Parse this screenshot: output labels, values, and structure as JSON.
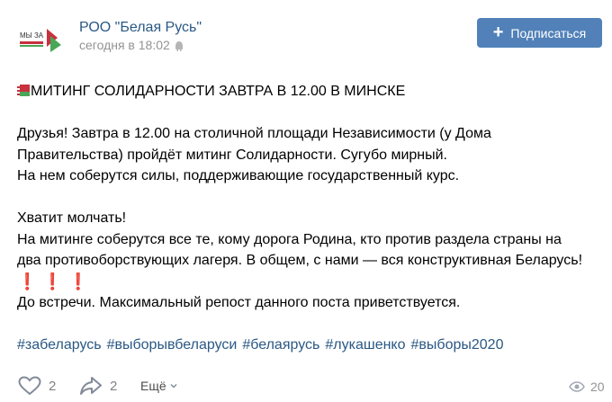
{
  "post": {
    "group_name": "РОО \"Белая Русь\"",
    "avatar_text": "МЫ ЗА",
    "time": "сегодня в 18:02",
    "subscribe_label": "Подписаться",
    "title": "МИТИНГ СОЛИДАРНОСТИ ЗАВТРА В 12.00 В МИНСКЕ",
    "paragraph1": [
      "Друзья! Завтра в 12.00 на столичной площади Независимости (у Дома",
      "Правительства) пройдёт митинг Солидарности. Сугубо мирный.",
      "На нем соберутся силы, поддерживающие государственный курс."
    ],
    "paragraph2": [
      "Хватит молчать!",
      "На митинге соберутся все те, кому дорога Родина, кто против раздела страны на",
      "два противоборствующих лагеря. В общем, с нами — вся конструктивная Беларусь!"
    ],
    "exclamations": "❗❗❗",
    "closing": "До встречи. Максимальный репост данного поста приветствуется.",
    "hashtags": [
      "#забеларусь",
      "#выборывбеларуси",
      "#белаярусь",
      "#лукашенко",
      "#выборы2020"
    ]
  },
  "footer": {
    "likes": "2",
    "shares": "2",
    "more_label": "Ещё",
    "views": "20"
  },
  "colors": {
    "accent": "#5181b8",
    "link": "#2a5885",
    "muted": "#939393",
    "flag_red": "#c8313e",
    "flag_green": "#4aa657"
  },
  "icons": {
    "subscribe": "plus-icon",
    "time": "android-icon",
    "like": "heart-icon",
    "share": "share-arrow-icon",
    "more": "chevron-down-icon",
    "views": "eye-icon",
    "title": "belarus-flag-icon"
  }
}
